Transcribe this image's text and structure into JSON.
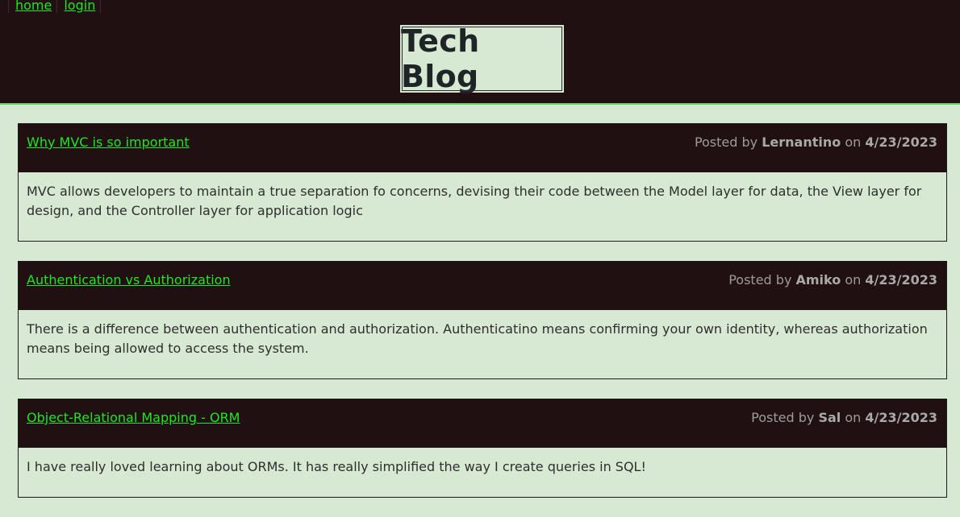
{
  "nav": {
    "home_label": "home",
    "login_label": "login"
  },
  "header": {
    "title": "Tech Blog"
  },
  "posts": [
    {
      "title": "Why MVC is so important",
      "posted_by_prefix": "Posted by",
      "author": "Lernantino",
      "on_word": "on",
      "date": "4/23/2023",
      "body": "MVC allows developers to maintain a true separation fo concerns, devising their code between the Model layer for data, the View layer for design, and the Controller layer for application logic"
    },
    {
      "title": "Authentication vs Authorization",
      "posted_by_prefix": "Posted by",
      "author": "Amiko",
      "on_word": "on",
      "date": "4/23/2023",
      "body": "There is a difference between authentication and authorization. Authenticatino means confirming your own identity, whereas authorization means being allowed to access the system."
    },
    {
      "title": "Object-Relational Mapping - ORM",
      "posted_by_prefix": "Posted by",
      "author": "Sal",
      "on_word": "on",
      "date": "4/23/2023",
      "body": "I have really loved learning about ORMs. It has really simplified the way I create queries in SQL!"
    }
  ],
  "colors": {
    "page_bg": "#d7e8d3",
    "header_bg": "#211011",
    "link_green": "#1ee81e",
    "meta_gray": "#9c9c9c"
  }
}
